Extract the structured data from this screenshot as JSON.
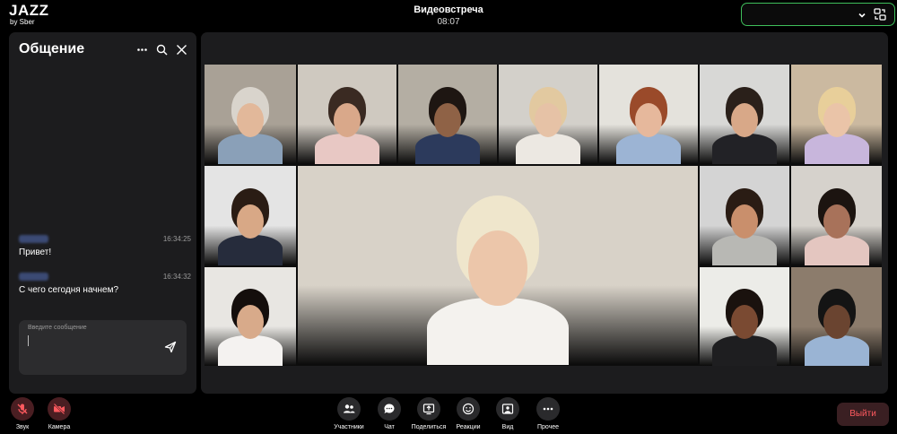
{
  "brand": {
    "name": "JAZZ",
    "sub": "by Sber"
  },
  "meeting": {
    "title": "Видеовстреча",
    "time": "08:07"
  },
  "chat": {
    "title": "Общение",
    "messages": [
      {
        "time": "16:34:25",
        "text": "Привет!"
      },
      {
        "time": "16:34:32",
        "text": "С чего сегодня начнем?"
      }
    ],
    "input_placeholder": "Введите сообщение"
  },
  "controls": {
    "sound": "Звук",
    "camera": "Камера",
    "participants": "Участники",
    "chat": "Чат",
    "share": "Поделиться",
    "reactions": "Реакции",
    "view": "Вид",
    "more": "Прочее",
    "leave": "Выйти"
  },
  "colors": {
    "accent_green": "#3fbf5b",
    "danger_red": "#ff5a5f",
    "panel_bg": "#1c1c1e",
    "mic_off_bg": "#4a1e22"
  },
  "icons": [
    "more-icon",
    "search-icon",
    "close-icon",
    "chevron-down-icon",
    "swap-screen-icon",
    "send-icon",
    "mic-off-icon",
    "camera-off-icon",
    "participants-icon",
    "chat-icon",
    "share-screen-icon",
    "reactions-icon",
    "view-icon",
    "more-options-icon"
  ]
}
